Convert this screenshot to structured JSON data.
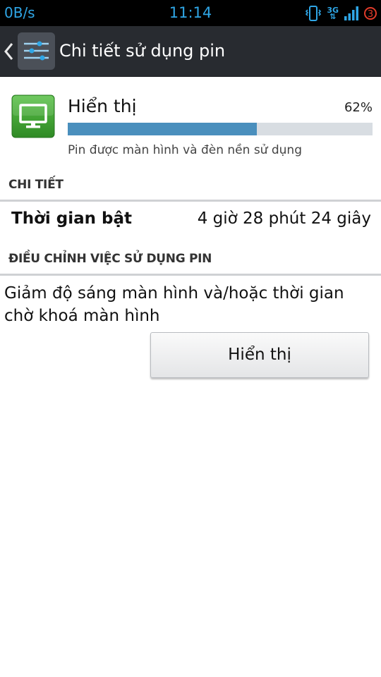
{
  "status_bar": {
    "network_speed": "0B/s",
    "time": "11:14",
    "network_type": "3G",
    "notification_count": "3",
    "colors": {
      "accent": "#2fa6e6",
      "badge": "#e23b2a"
    },
    "icons": [
      "vibrate-icon",
      "network-3g-icon",
      "signal-icon",
      "notification-badge-icon"
    ]
  },
  "action_bar": {
    "title": "Chi tiết sử dụng pin",
    "icons": [
      "back-chevron-icon",
      "settings-sliders-icon"
    ],
    "background": "#282b30"
  },
  "usage": {
    "app_name": "Hiển thị",
    "percent_label": "62%",
    "percent_value": 0.62,
    "description": "Pin được màn hình và đèn nền sử dụng",
    "icon": "monitor-icon",
    "bar_color": "#4a8fbd"
  },
  "details": {
    "header": "CHI TIẾT",
    "on_time_label": "Thời gian bật",
    "on_time_value": "4 giờ 28 phút 24 giây"
  },
  "adjust": {
    "header": "ĐIỀU CHỈNH VIỆC SỬ DỤNG PIN",
    "advice": "Giảm độ sáng màn hình và/hoặc thời gian chờ khoá màn hình",
    "button_label": "Hiển thị"
  }
}
